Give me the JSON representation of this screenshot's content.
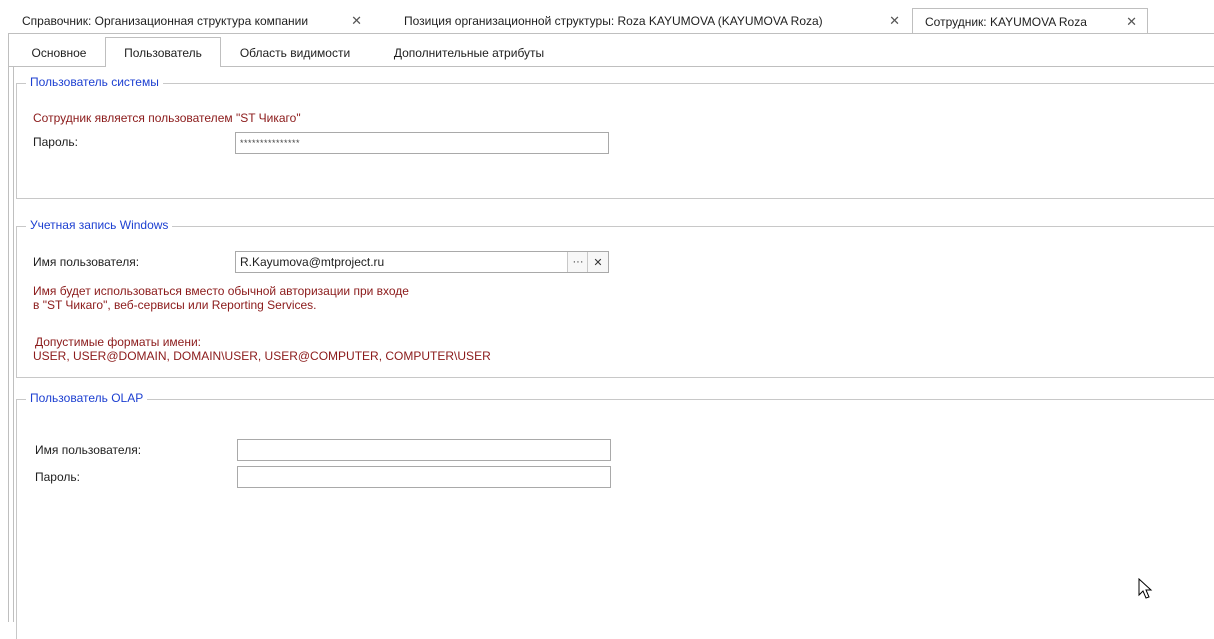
{
  "doc_tabs": [
    {
      "label": "Справочник: Организационная структура компании"
    },
    {
      "label": "Позиция организационной структуры: Roza KAYUMOVA (KAYUMOVA Roza)"
    },
    {
      "label": "Сотрудник: KAYUMOVA Roza"
    }
  ],
  "inner_tabs": [
    {
      "label": "Основное"
    },
    {
      "label": "Пользователь"
    },
    {
      "label": "Область видимости"
    },
    {
      "label": "Дополнительные атрибуты"
    }
  ],
  "system_user": {
    "title": "Пользователь системы",
    "info": "Сотрудник является пользователем \"ST Чикаго\"",
    "password_label": "Пароль:",
    "password_value": "***************"
  },
  "windows_account": {
    "title": "Учетная запись Windows",
    "username_label": "Имя пользователя:",
    "username_value": "R.Kayumova@mtproject.ru",
    "hint_line1": "Имя будет использоваться вместо обычной авторизации при входе",
    "hint_line2": "в \"ST Чикаго\", веб-сервисы или Reporting Services.",
    "formats_title": "Допустимые форматы имени:",
    "formats_value": "USER, USER@DOMAIN, DOMAIN\\USER, USER@COMPUTER, COMPUTER\\USER",
    "browse_glyph": "···",
    "clear_glyph": "✕"
  },
  "olap_user": {
    "title": "Пользователь OLAP",
    "username_label": "Имя пользователя:",
    "username_value": "",
    "password_label": "Пароль:",
    "password_value": ""
  },
  "icons": {
    "close_glyph": "✕"
  },
  "colors": {
    "group_title": "#1c3fd1",
    "warning_text": "#8b1a1a",
    "border": "#bfbfbf"
  }
}
